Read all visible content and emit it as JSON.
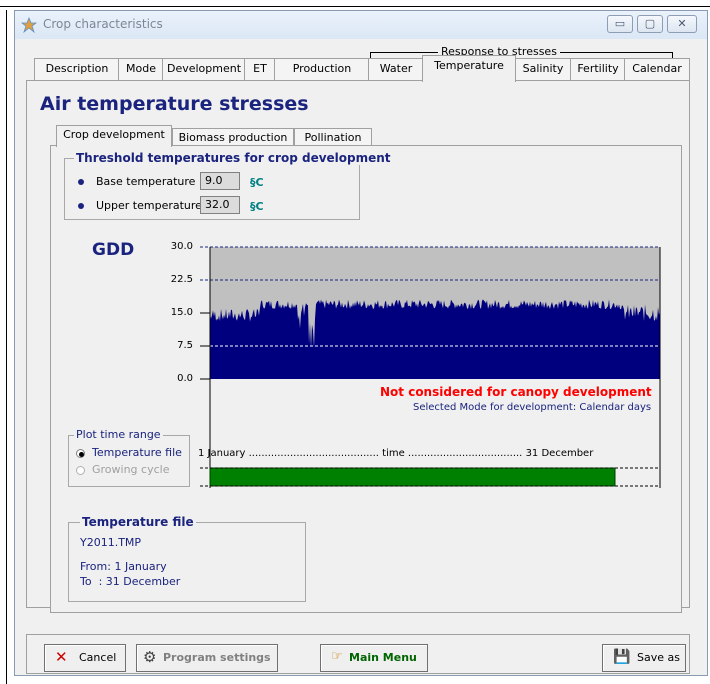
{
  "window": {
    "title": "Crop characteristics",
    "controls": [
      "▭",
      "▢",
      "✕"
    ]
  },
  "tabs": [
    "Description",
    "Mode",
    "Development",
    "ET",
    "Production",
    "Water",
    "Temperature",
    "Salinity",
    "Fertility",
    "Calendar"
  ],
  "tab_group_label": "Response to stresses",
  "active_tab": "Temperature",
  "page_title": "Air temperature stresses",
  "subtabs": [
    "Crop development",
    "Biomass production",
    "Pollination"
  ],
  "threshold": {
    "title": "Threshold temperatures for crop development",
    "base_label": "Base temperature",
    "base_value": "9.0",
    "upper_label": "Upper temperature",
    "upper_value": "32.0",
    "unit": "§C"
  },
  "chart": {
    "gdd_label": "GDD",
    "not_considered": "Not considered for canopy development",
    "mode_text": "Selected Mode for development: Calendar days",
    "time_start": "1 January",
    "time_middle": "time",
    "time_end": "31 December",
    "dots_left": " .........................................",
    "dots_right": " ...................................."
  },
  "chart_data": {
    "type": "area",
    "yticks": [
      "30.0",
      "22.5",
      "15.0",
      "7.5",
      "0.0"
    ],
    "ylim": [
      0,
      30
    ],
    "gdd_mean": 17,
    "fill_color": "#00007f",
    "background_color": "#c0c0c0",
    "bar_color": "#008000",
    "cycle_fraction": 0.9
  },
  "plot_range": {
    "title": "Plot time range",
    "option1": "Temperature file",
    "option2": "Growing cycle",
    "selected": "Temperature file"
  },
  "temp_file": {
    "title": "Temperature file",
    "name": "Y2011.TMP",
    "from": "From: 1 January",
    "to": "To  : 31 December"
  },
  "buttons": {
    "cancel": "Cancel",
    "program_settings": "Program settings",
    "main_menu": "Main Menu",
    "save_as": "Save as"
  }
}
